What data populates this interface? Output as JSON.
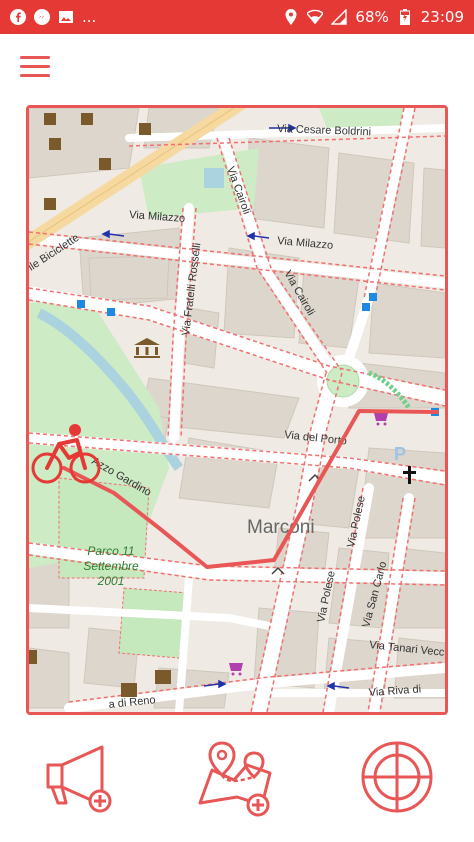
{
  "status_bar": {
    "icons_left": [
      "facebook-icon",
      "messenger-icon",
      "gallery-icon"
    ],
    "more": "...",
    "icons_right": [
      "location-icon",
      "wifi-icon",
      "signal-icon"
    ],
    "battery": "68%",
    "time": "23:09",
    "bg_color": "#e53935"
  },
  "accent_color": "#e85656",
  "map": {
    "labels": {
      "via_cesare_boldrini": "Via Cesare Boldrini",
      "via_milazzo_1": "Via Milazzo",
      "via_milazzo_2": "Via Milazzo",
      "via_cairoli_1": "Via Cairoli",
      "via_cairoli_2": "Via Cairoli",
      "via_fratelli_rosselli": "Via Fratelli Rosselli",
      "delle_biciclette": "lle Biciclette",
      "via_del_porto": "Via del Porto",
      "via_azzo_gardino": "Azzo Gardino",
      "marconi": "Marconi",
      "parco_line1": "Parco 11",
      "parco_line2": "Settembre",
      "parco_line3": "2001",
      "via_polese_1": "Via Polese",
      "via_polese_2": "Via Polese",
      "via_san_carlo": "Via San Carlo",
      "via_tanari": "Via Tanari Vecc",
      "via_riva": "Via Riva di",
      "via_di_reno": "a di Reno",
      "p_marker": "P"
    }
  },
  "actions": {
    "report": "report-megaphone-button",
    "route": "add-route-button",
    "locate": "locate-button"
  }
}
